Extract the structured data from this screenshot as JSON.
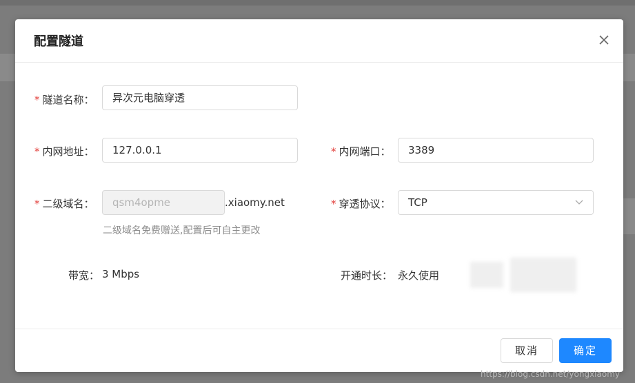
{
  "dialog": {
    "title": "配置隧道",
    "fields": {
      "tunnel_name": {
        "label": "隧道名称：",
        "value": "异次元电脑穿透"
      },
      "local_address": {
        "label": "内网地址：",
        "value": "127.0.0.1"
      },
      "local_port": {
        "label": "内网端口：",
        "value": "3389"
      },
      "subdomain": {
        "label": "二级域名：",
        "value": "qsm4opme",
        "suffix": ".xiaomy.net",
        "hint": "二级域名免费赠送,配置后可自主更改"
      },
      "protocol": {
        "label": "穿透协议：",
        "value": "TCP"
      }
    },
    "info": {
      "bandwidth_label": "带宽：",
      "bandwidth_value": "3 Mbps",
      "duration_label": "开通时长：",
      "duration_value": "永久使用"
    },
    "buttons": {
      "cancel": "取消",
      "ok": "确定"
    }
  },
  "watermark": "https://blog.csdn.net/yongxiaomy",
  "colors": {
    "primary": "#1e88ff",
    "required": "#e2403c"
  }
}
